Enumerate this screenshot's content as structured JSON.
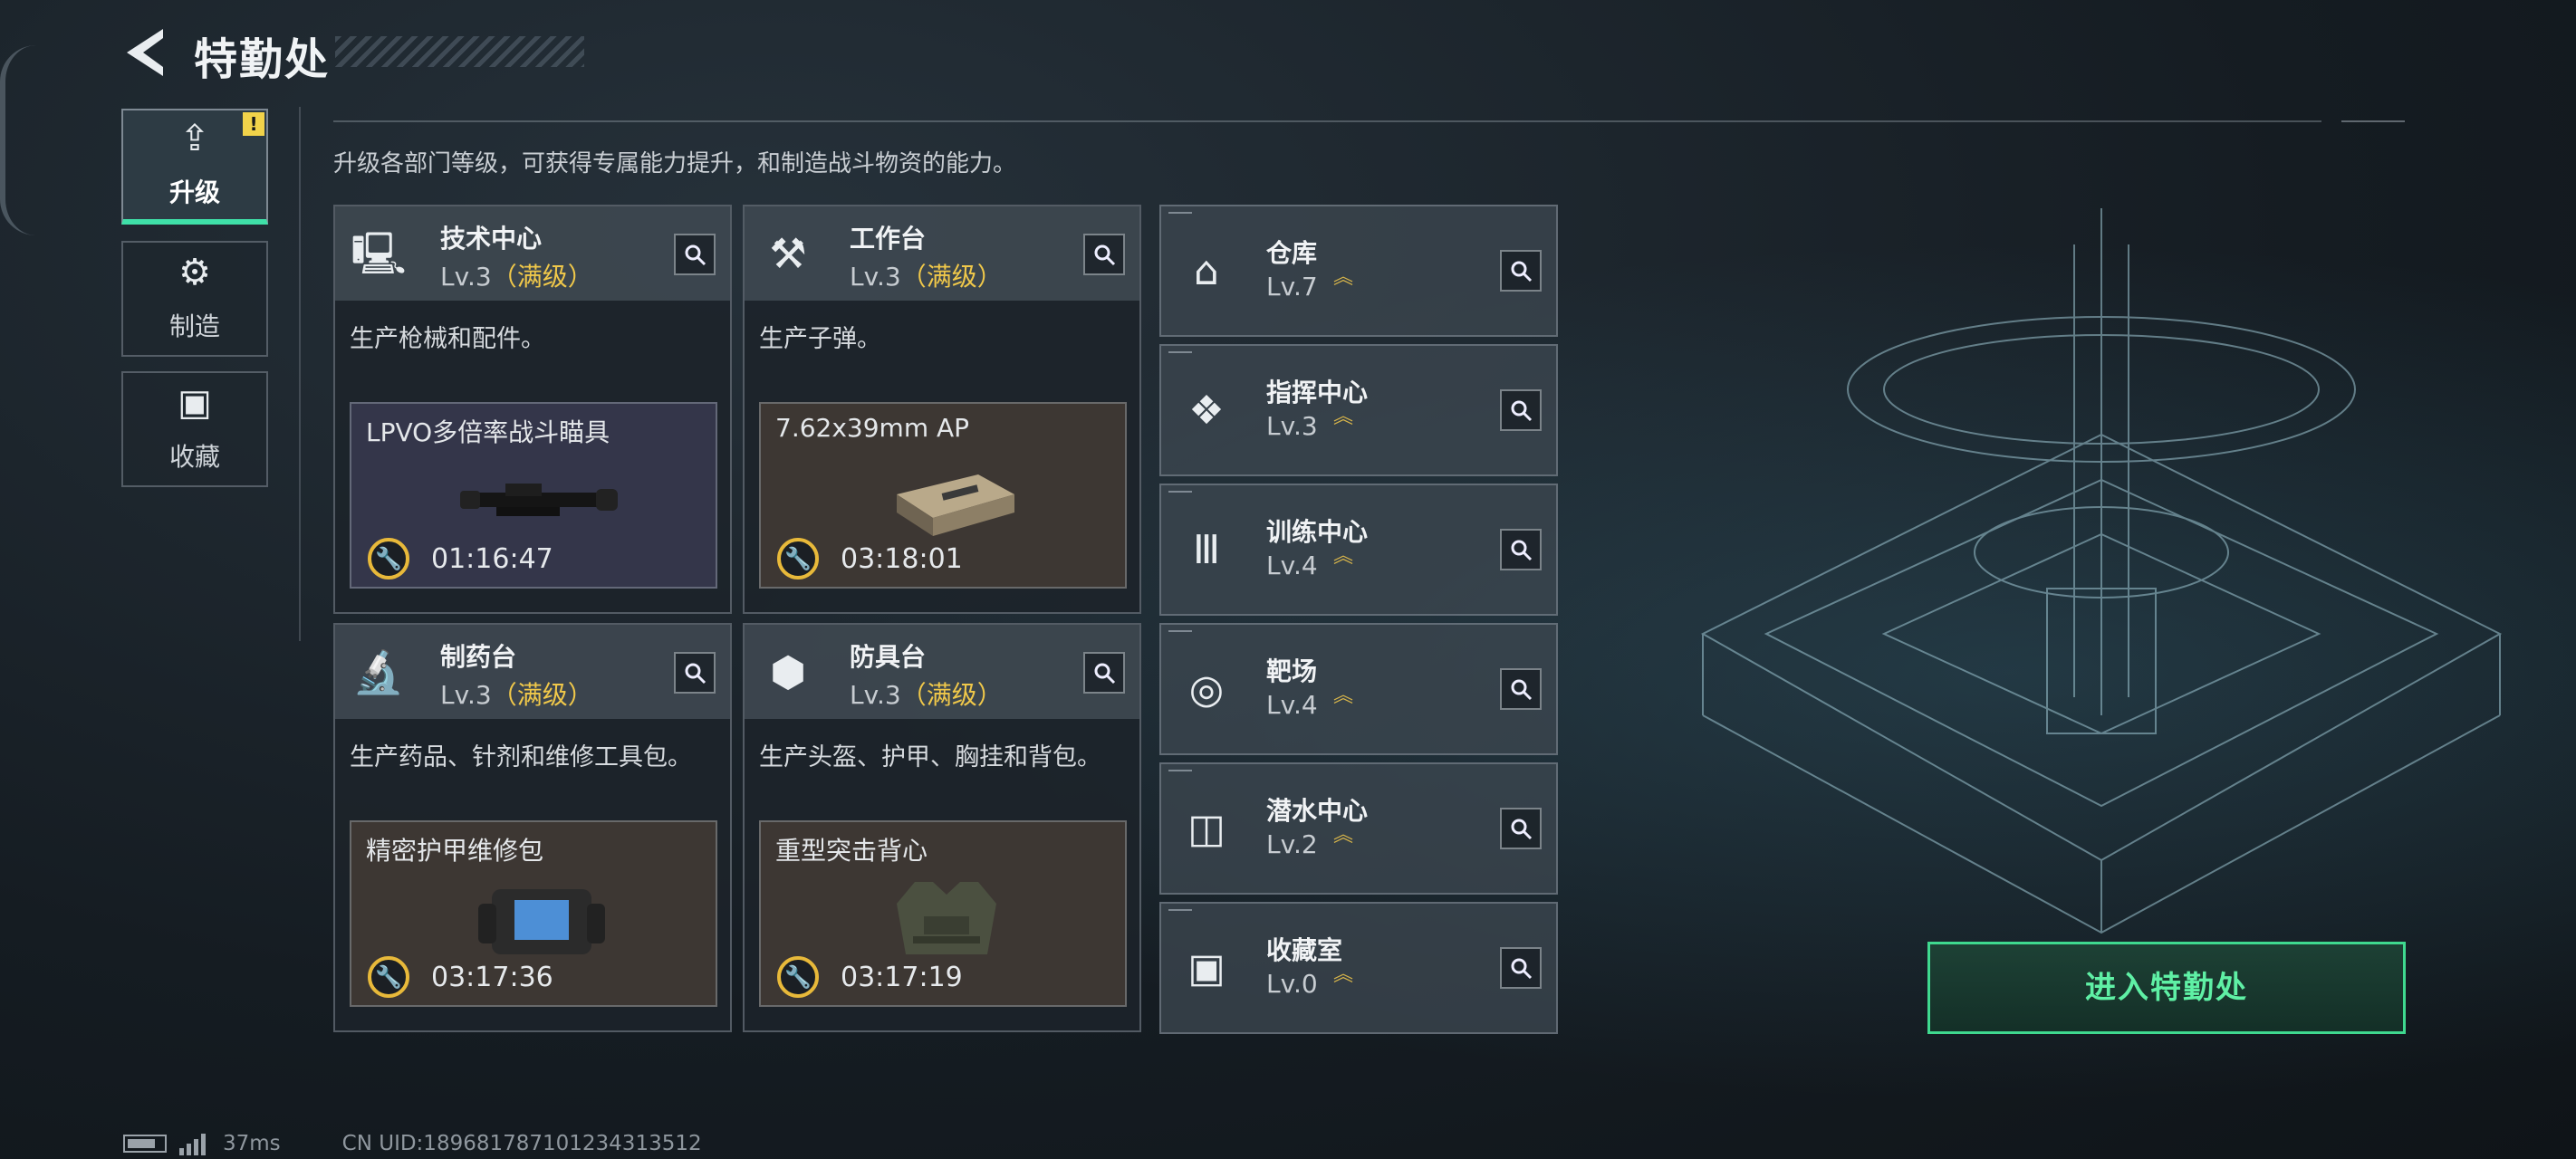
{
  "header": {
    "title": "特勤处"
  },
  "nav": [
    {
      "label": "升级",
      "icon": "upgrade-icon",
      "active": true,
      "badge": "!"
    },
    {
      "label": "制造",
      "icon": "gear-icon",
      "active": false
    },
    {
      "label": "收藏",
      "icon": "collection-icon",
      "active": false
    }
  ],
  "description": "升级各部门等级，可获得专属能力提升，和制造战斗物资的能力。",
  "departments": [
    {
      "name": "技术中心",
      "level": "Lv.3",
      "status": "（满级）",
      "icon": "computer-icon",
      "desc": "生产枪械和配件。",
      "product": "LPVO多倍率战斗瞄具",
      "timer": "01:16:47",
      "product_bg": "#34364a"
    },
    {
      "name": "工作台",
      "level": "Lv.3",
      "status": "（满级）",
      "icon": "tools-icon",
      "desc": "生产子弹。",
      "product": "7.62x39mm AP",
      "timer": "03:18:01",
      "product_bg": "#3d3733"
    },
    {
      "name": "制药台",
      "level": "Lv.3",
      "status": "（满级）",
      "icon": "microscope-icon",
      "desc": "生产药品、针剂和维修工具包。",
      "product": "精密护甲维修包",
      "timer": "03:17:36",
      "product_bg": "#3d3733"
    },
    {
      "name": "防具台",
      "level": "Lv.3",
      "status": "（满级）",
      "icon": "armor-blocks-icon",
      "desc": "生产头盔、护甲、胸挂和背包。",
      "product": "重型突击背心",
      "timer": "03:17:19",
      "product_bg": "#3d3733"
    }
  ],
  "facilities": [
    {
      "name": "仓库",
      "level": "Lv.7",
      "icon": "warehouse-icon"
    },
    {
      "name": "指挥中心",
      "level": "Lv.3",
      "icon": "command-icon"
    },
    {
      "name": "训练中心",
      "level": "Lv.4",
      "icon": "dumbbell-icon"
    },
    {
      "name": "靶场",
      "level": "Lv.4",
      "icon": "target-icon"
    },
    {
      "name": "潜水中心",
      "level": "Lv.2",
      "icon": "diving-mask-icon"
    },
    {
      "name": "收藏室",
      "level": "Lv.0",
      "icon": "collection-room-icon"
    }
  ],
  "enter_button": "进入特勤处",
  "footer": {
    "ping": "37ms",
    "uid": "CN UID:189681787101234313512"
  },
  "colors": {
    "accent": "#3fe0a8",
    "maxed": "#f0c84a",
    "timer_ring": "#e8b93a"
  }
}
